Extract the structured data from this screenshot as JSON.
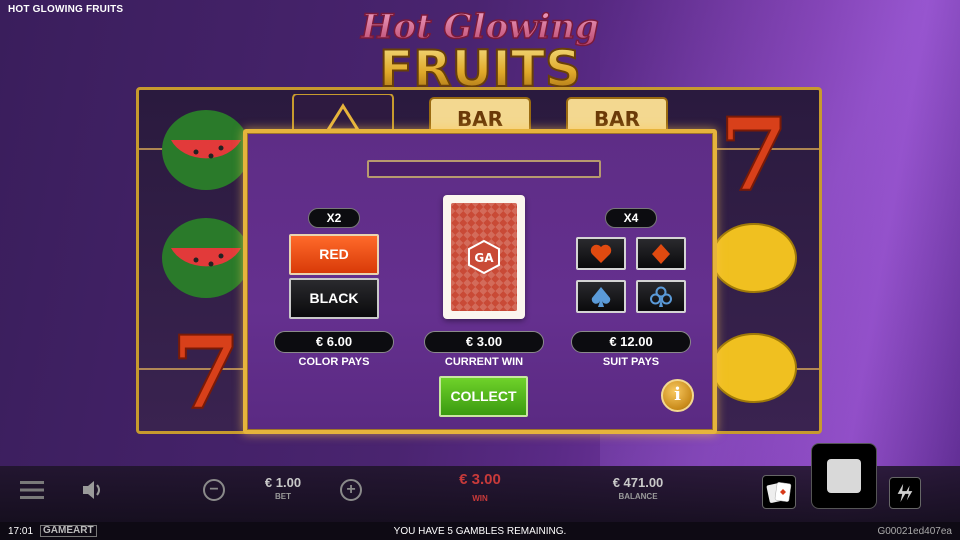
{
  "header": {
    "game_title": "HOT GLOWING FRUITS"
  },
  "logo": {
    "line1": "Hot Glowing",
    "line2": "FRUITS"
  },
  "reels": {
    "symbols_col1": [
      "watermelon",
      "watermelon",
      "seven"
    ],
    "symbols_col2": [
      "triangle-icon"
    ],
    "symbols_col3": [
      "BAR"
    ],
    "symbols_col4": [
      "BAR"
    ],
    "symbols_col5": [
      "seven",
      "lemon",
      "lemon"
    ]
  },
  "gamble": {
    "color_multiplier": "X2",
    "suit_multiplier": "X4",
    "red_label": "RED",
    "black_label": "BLACK",
    "color_pays_value": "€ 6.00",
    "color_pays_label": "COLOR PAYS",
    "current_win_value": "€ 3.00",
    "current_win_label": "CURRENT WIN",
    "suit_pays_value": "€ 12.00",
    "suit_pays_label": "SUIT PAYS",
    "collect_label": "COLLECT",
    "info_label": "i",
    "suits": [
      "heart-icon",
      "diamond-icon",
      "spade-icon",
      "club-icon"
    ],
    "card_logo": "GA"
  },
  "controls": {
    "bet_value": "€ 1.00",
    "bet_label": "BET",
    "win_value": "€ 3.00",
    "win_label": "WIN",
    "balance_value": "€ 471.00",
    "balance_label": "BALANCE",
    "minus_label": "−",
    "plus_label": "+"
  },
  "footer": {
    "time": "17:01",
    "brand": "GAMEART",
    "message": "YOU HAVE 5 GAMBLES REMAINING.",
    "session_id": "G00021ed407ea"
  },
  "colors": {
    "accent_gold": "#e6b43c",
    "red_button": "#e04a10",
    "collect_green": "#4cb41a",
    "win_red": "#c83a3a"
  }
}
